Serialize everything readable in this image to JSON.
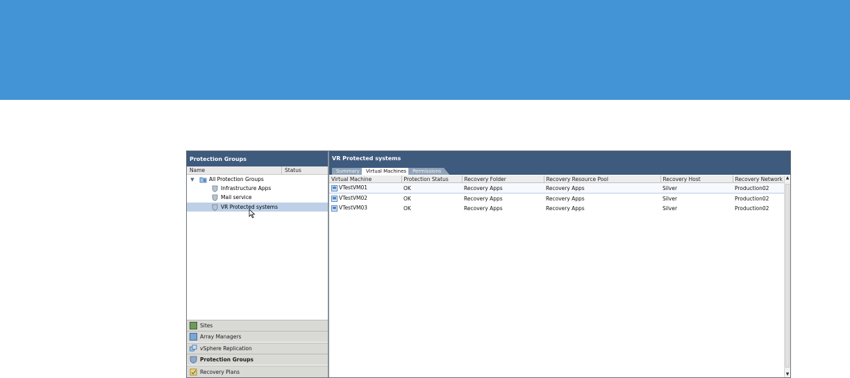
{
  "left_panel": {
    "title": "Protection Groups",
    "columns": [
      "Name",
      "Status"
    ],
    "tree": [
      {
        "label": "All Protection Groups",
        "expanded": true,
        "icon": "protection-groups-folder-icon"
      },
      {
        "label": "Infrastructure Apps",
        "icon": "shield-icon"
      },
      {
        "label": "Mail service",
        "icon": "shield-icon"
      },
      {
        "label": "VR Protected systems",
        "icon": "shield-icon",
        "selected": true
      }
    ],
    "nav": [
      {
        "label": "Sites",
        "icon": "sites-icon"
      },
      {
        "label": "Array Managers",
        "icon": "array-managers-icon"
      },
      {
        "label": "vSphere Replication",
        "icon": "vsphere-replication-icon"
      },
      {
        "label": "Protection Groups",
        "icon": "shield-icon",
        "active": true
      },
      {
        "label": "Recovery Plans",
        "icon": "recovery-plans-icon"
      }
    ]
  },
  "right_panel": {
    "title": "VR Protected systems",
    "tabs": [
      {
        "label": "Summary"
      },
      {
        "label": "Virtual Machines",
        "active": true
      },
      {
        "label": "Permissions"
      }
    ],
    "table": {
      "columns": [
        "Virtual Machine",
        "Protection Status",
        "Recovery Folder",
        "Recovery Resource Pool",
        "Recovery Host",
        "Recovery Network"
      ],
      "rows": [
        [
          "VTestVM01",
          "OK",
          "Recovery Apps",
          "Recovery Apps",
          "Silver",
          "Production02"
        ],
        [
          "VTestVM02",
          "OK",
          "Recovery Apps",
          "Recovery Apps",
          "Silver",
          "Production02"
        ],
        [
          "VTestVM03",
          "OK",
          "Recovery Apps",
          "Recovery Apps",
          "Silver",
          "Production02"
        ]
      ]
    }
  },
  "colors": {
    "banner": "#4294d6",
    "header": "#3e5a7d",
    "selection": "#bdd0e7"
  }
}
